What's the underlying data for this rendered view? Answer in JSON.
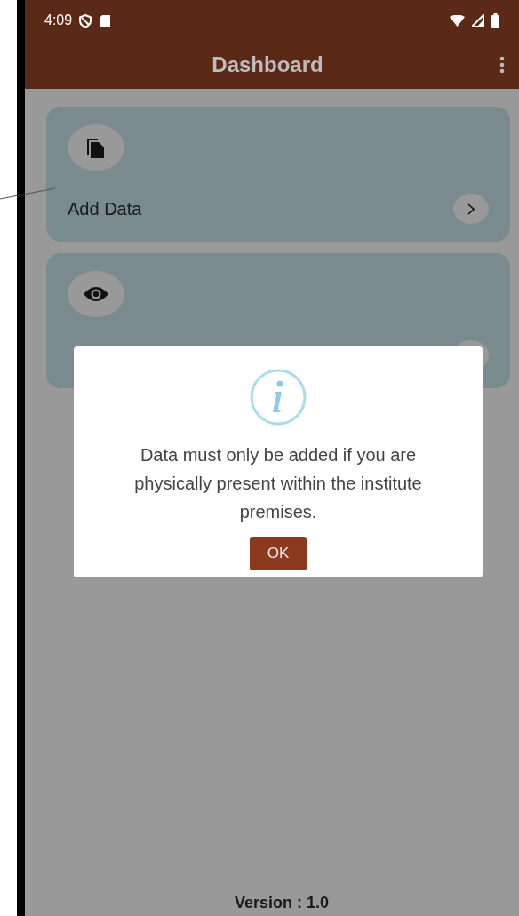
{
  "status_bar": {
    "time": "4:09"
  },
  "app_bar": {
    "title": "Dashboard"
  },
  "cards": [
    {
      "kind": "add",
      "label": "Add Data"
    },
    {
      "kind": "view"
    }
  ],
  "dialog": {
    "message": "Data must only be added if you are physically present within the institute premises.",
    "button": "OK"
  },
  "footer": {
    "version": "Version : 1.0"
  }
}
